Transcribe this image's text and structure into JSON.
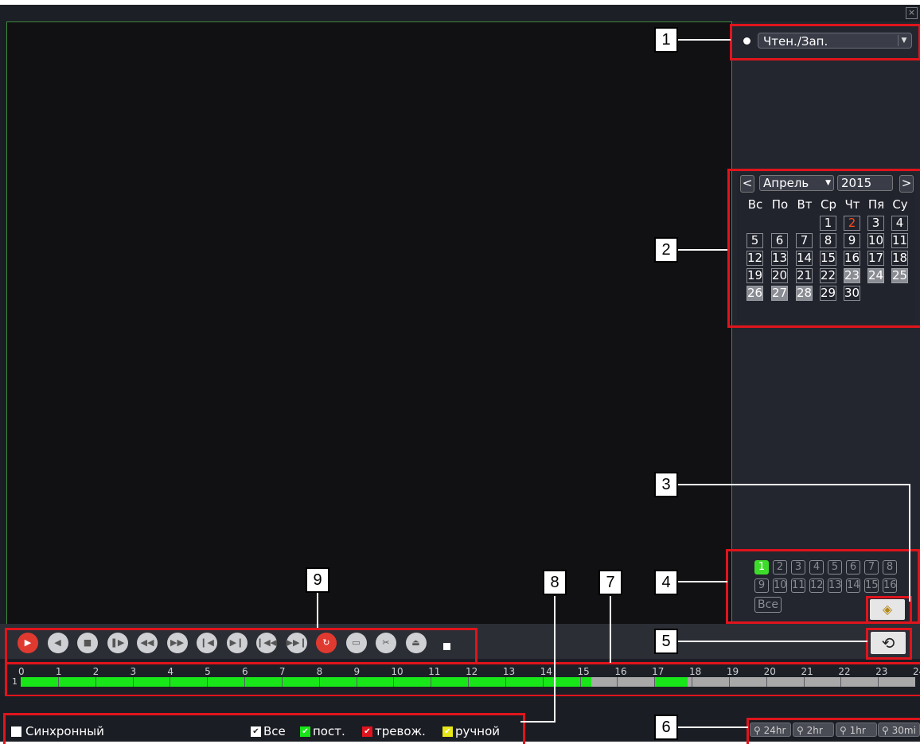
{
  "close_icon": "×",
  "mode_select": {
    "value": "Чтен./Зап."
  },
  "calendar": {
    "prev": "<",
    "next": ">",
    "month": "Апрель",
    "year": "2015",
    "weekdays": [
      "Вс",
      "По",
      "Вт",
      "Ср",
      "Чт",
      "Пя",
      "Су"
    ],
    "days": [
      "1",
      "2",
      "3",
      "4",
      "5",
      "6",
      "7",
      "8",
      "9",
      "10",
      "11",
      "12",
      "13",
      "14",
      "15",
      "16",
      "17",
      "18",
      "19",
      "20",
      "21",
      "22",
      "23",
      "24",
      "25",
      "26",
      "27",
      "28",
      "29",
      "30"
    ],
    "today": "2",
    "recorded_days": [
      "23",
      "24",
      "25",
      "26",
      "27",
      "28"
    ]
  },
  "channels": {
    "items": [
      "1",
      "2",
      "3",
      "4",
      "5",
      "6",
      "7",
      "8",
      "9",
      "10",
      "11",
      "12",
      "13",
      "14",
      "15",
      "16"
    ],
    "active": "1",
    "all_label": "Все"
  },
  "callouts": [
    "1",
    "2",
    "3",
    "4",
    "5",
    "6",
    "7",
    "8",
    "9"
  ],
  "timeline": {
    "hours": [
      "0",
      "1",
      "2",
      "3",
      "4",
      "5",
      "6",
      "7",
      "8",
      "9",
      "10",
      "11",
      "12",
      "13",
      "14",
      "15",
      "16",
      "17",
      "18",
      "19",
      "20",
      "21",
      "22",
      "23",
      "24"
    ],
    "channel_label": "1",
    "colors": {
      "constant": "#19e619",
      "none": "#a8a8a8"
    },
    "segments": [
      {
        "from": 0,
        "to": 15.3,
        "type": "constant"
      },
      {
        "from": 15.3,
        "to": 17.0,
        "type": "none"
      },
      {
        "from": 17.0,
        "to": 17.9,
        "type": "constant"
      },
      {
        "from": 17.9,
        "to": 24,
        "type": "none"
      }
    ]
  },
  "filters": {
    "sync": "Синхронный",
    "all": "Все",
    "constant": "пост.",
    "alarm": "тревож.",
    "manual": "ручной",
    "alarm_color": "#e0141c",
    "manual_color": "#e6e619"
  },
  "zoom": [
    "24hr",
    "2hr",
    "1hr",
    "30mi"
  ]
}
